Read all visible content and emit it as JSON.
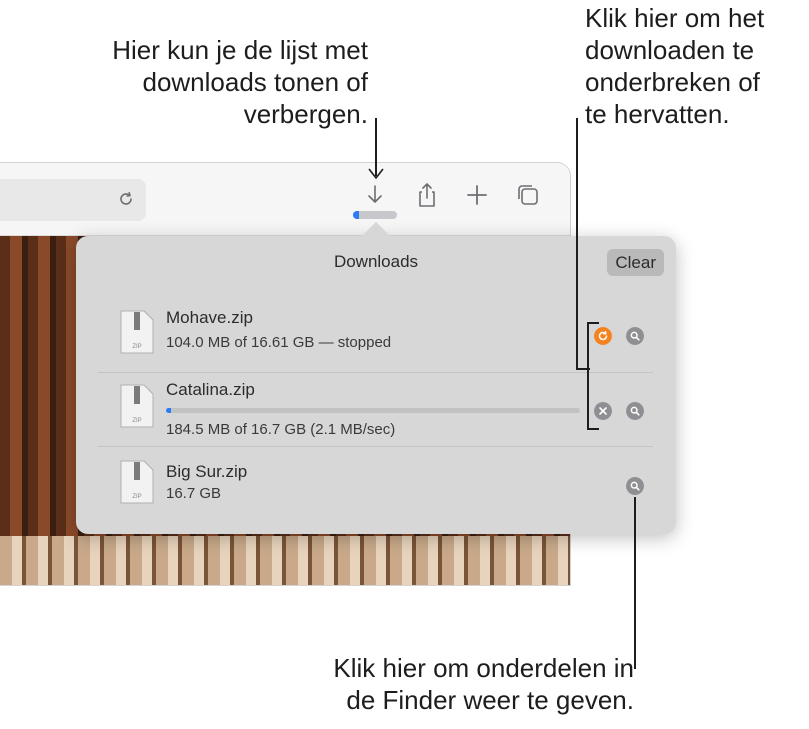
{
  "callouts": {
    "toggle_list": "Hier kun je de lijst met\ndownloads tonen of\nverbergen.",
    "pause_resume": "Klik hier om het\ndownloaden te\nonderbreken of\nte hervatten.",
    "show_in_finder": "Klik hier om onderdelen in\nde Finder weer te geven."
  },
  "toolbar": {
    "icons": [
      "reload-icon",
      "download-arrow-icon",
      "share-icon",
      "new-tab-icon",
      "tab-overview-icon"
    ],
    "download_progress_fraction": 0.011
  },
  "downloads": {
    "title": "Downloads",
    "clear_label": "Clear",
    "items": [
      {
        "name": "Mohave.zip",
        "status": "104.0 MB of 16.61 GB — stopped",
        "state": "stopped"
      },
      {
        "name": "Catalina.zip",
        "status": "184.5 MB of 16.7 GB (2.1 MB/sec)",
        "state": "downloading",
        "progress_fraction": 0.011
      },
      {
        "name": "Big Sur.zip",
        "status": "16.7 GB",
        "state": "complete"
      }
    ],
    "file_icon_label": "ZIP"
  },
  "colors": {
    "resume_button": "#f5821f",
    "progress": "#2d7cf6",
    "button_gray": "#8e8e93"
  }
}
